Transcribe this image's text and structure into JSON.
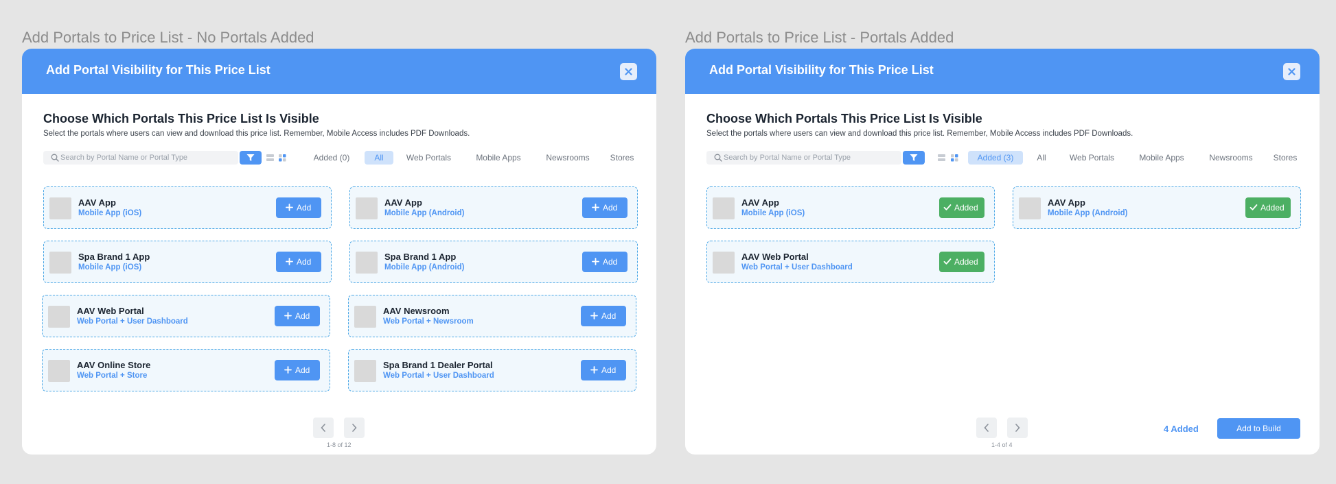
{
  "colors": {
    "accent": "#4f95f3",
    "added_green": "#4caf63",
    "card_border": "#48a6e6",
    "background": "#e5e5e5"
  },
  "frames": [
    {
      "frame_title": "Add Portals to Price List - No Portals Added",
      "modal_title": "Add Portal Visibility for This Price List",
      "close_icon": "close-icon",
      "heading": "Choose Which Portals This Price List Is Visible",
      "subtitle": "Select the portals where users can view and download this price list. Remember, Mobile Access includes PDF Downloads.",
      "search_placeholder": "Search by Portal Name or Portal Type",
      "chips": [
        "Added (0)",
        "All",
        "Web Portals",
        "Mobile Apps",
        "Newsrooms",
        "Stores"
      ],
      "active_chip": "All",
      "cards": [
        {
          "name": "AAV App",
          "type": "Mobile App (iOS)",
          "button": "Add"
        },
        {
          "name": "AAV App",
          "type": "Mobile App (Android)",
          "button": "Add"
        },
        {
          "name": "Spa Brand 1 App",
          "type": "Mobile App (iOS)",
          "button": "Add"
        },
        {
          "name": "Spa Brand 1 App",
          "type": "Mobile App (Android)",
          "button": "Add"
        },
        {
          "name": "AAV Web Portal",
          "type": "Web Portal + User Dashboard",
          "button": "Add"
        },
        {
          "name": "AAV Newsroom",
          "type": "Web Portal + Newsroom",
          "button": "Add"
        },
        {
          "name": "AAV Online Store",
          "type": "Web Portal + Store",
          "button": "Add"
        },
        {
          "name": "Spa Brand 1 Dealer Portal",
          "type": "Web Portal + User Dashboard",
          "button": "Add"
        }
      ],
      "pagination": "1-8 of 12"
    },
    {
      "frame_title": "Add Portals to Price List - Portals Added",
      "modal_title": "Add Portal Visibility for This Price List",
      "close_icon": "close-icon",
      "heading": "Choose Which Portals This Price List Is Visible",
      "subtitle": "Select the portals where users can view and download this price list. Remember, Mobile Access includes PDF Downloads.",
      "search_placeholder": "Search by Portal Name or Portal Type",
      "chips": [
        "Added (3)",
        "All",
        "Web Portals",
        "Mobile Apps",
        "Newsrooms",
        "Stores"
      ],
      "active_chip": "Added (3)",
      "cards": [
        {
          "name": "AAV App",
          "type": "Mobile App (iOS)",
          "button": "Added"
        },
        {
          "name": "AAV App",
          "type": "Mobile App (Android)",
          "button": "Added"
        },
        {
          "name": "AAV Web Portal",
          "type": "Web Portal + User Dashboard",
          "button": "Added"
        }
      ],
      "pagination": "1-4 of 4",
      "added_count": "4 Added",
      "add_to_build": "Add to Build"
    }
  ]
}
